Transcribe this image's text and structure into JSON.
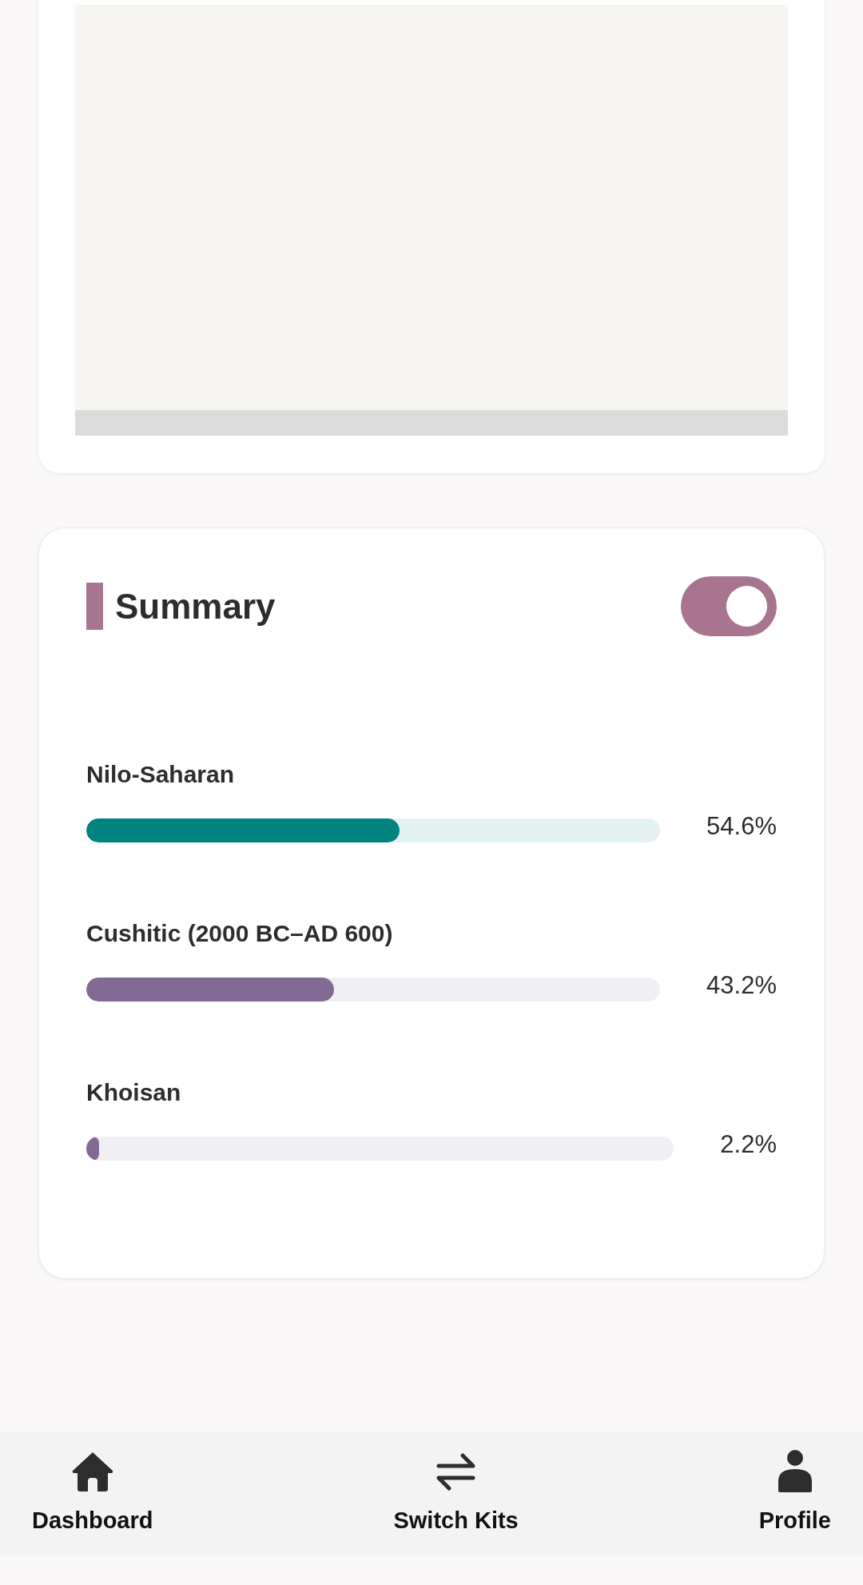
{
  "summary": {
    "title": "Summary",
    "toggle": {
      "on": true
    },
    "items": [
      {
        "label": "Nilo-Saharan",
        "level": 0.546,
        "value": "54.6%",
        "color": "#00827f"
      },
      {
        "label": "Cushitic (2000 BC–AD 600)",
        "level": 0.432,
        "value": "43.2%",
        "color": "#826a94"
      },
      {
        "label": "Khoisan",
        "level": 0.022,
        "value": "2.2%",
        "color": "#826a94"
      }
    ]
  },
  "nav": [
    {
      "kind": "home",
      "label": "Dashboard"
    },
    {
      "kind": "switch",
      "label": "Switch Kits"
    },
    {
      "kind": "person",
      "label": "Profile"
    }
  ]
}
